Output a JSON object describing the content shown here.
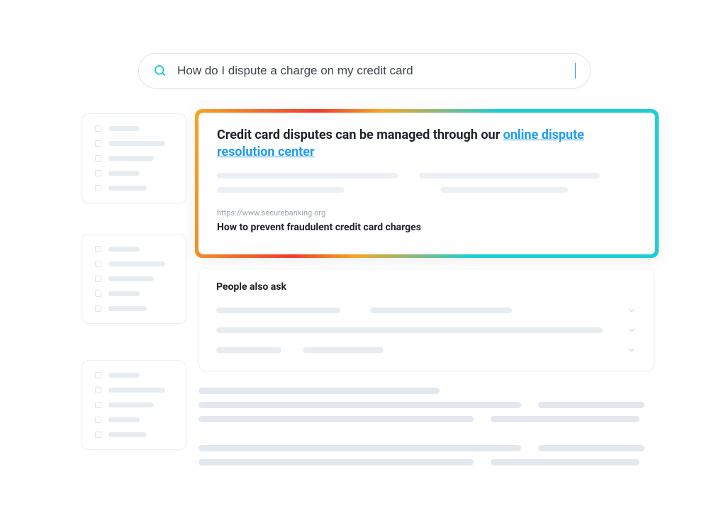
{
  "search": {
    "query": "How do I dispute a charge on my credit card"
  },
  "featured": {
    "title_plain": "Credit card disputes can be managed through our",
    "link_text": "online dispute resolution center",
    "url": "https://www.securebanking.org",
    "sub_title": "How to prevent fraudulent credit card charges"
  },
  "paa": {
    "title": "People also ask"
  }
}
